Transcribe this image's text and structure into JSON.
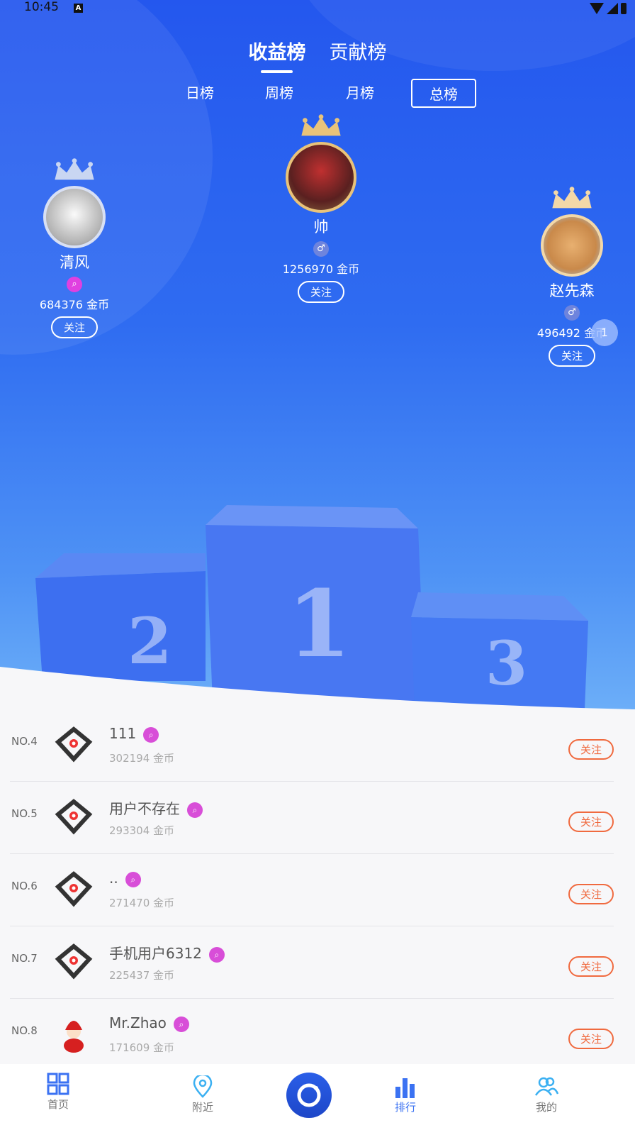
{
  "status": {
    "time": "10:45",
    "sim": "A"
  },
  "top_tabs": [
    "收益榜",
    "贡献榜"
  ],
  "periods": [
    "日榜",
    "周榜",
    "月榜",
    "总榜"
  ],
  "podium": [
    {
      "rank": 1,
      "name": "帅",
      "coins": "1256970 金币",
      "follow": "关注",
      "badge": "♂"
    },
    {
      "rank": 2,
      "name": "清风",
      "coins": "684376 金币",
      "follow": "关注",
      "badge": "⌕"
    },
    {
      "rank": 3,
      "name": "赵先森",
      "coins": "496492 金币",
      "follow": "关注",
      "badge": "♂"
    }
  ],
  "podium_digits": [
    "2",
    "1",
    "3"
  ],
  "floating_badge": "1",
  "list": [
    {
      "rank": "NO.4",
      "name": "111",
      "coins": "302194 金币",
      "follow": "关注"
    },
    {
      "rank": "NO.5",
      "name": "用户不存在",
      "coins": "293304 金币",
      "follow": "关注"
    },
    {
      "rank": "NO.6",
      "name": "..",
      "coins": "271470 金币",
      "follow": "关注"
    },
    {
      "rank": "NO.7",
      "name": "手机用户6312",
      "coins": "225437 金币",
      "follow": "关注"
    },
    {
      "rank": "NO.8",
      "name": "Mr.Zhao",
      "coins": "171609 金币",
      "follow": "关注"
    }
  ],
  "tabbar": {
    "home": "首页",
    "nearby": "附近",
    "rank": "排行",
    "mine": "我的"
  },
  "colors": {
    "primary": "#2f6cf1",
    "follow": "#f06a3f",
    "badge": "#d84ed8"
  }
}
